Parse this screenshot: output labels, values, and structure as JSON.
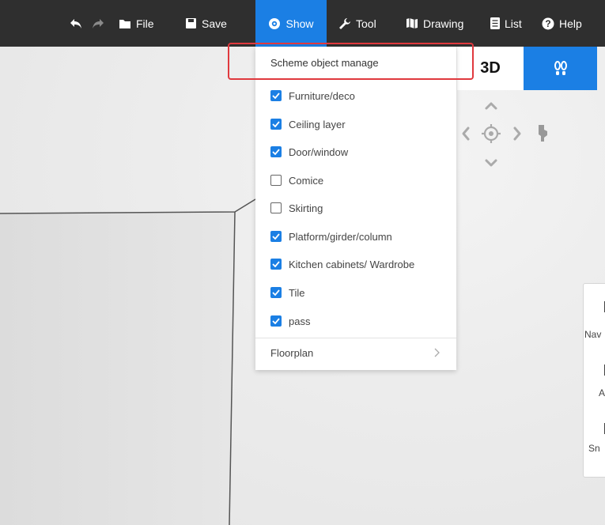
{
  "toolbar": {
    "items": [
      {
        "icon": "undo-icon",
        "label": ""
      },
      {
        "icon": "redo-icon",
        "label": ""
      },
      {
        "icon": "folder-icon",
        "label": "File"
      },
      {
        "icon": "save-icon",
        "label": "Save"
      },
      {
        "icon": "eye-icon",
        "label": "Show"
      },
      {
        "icon": "wrench-icon",
        "label": "Tool"
      },
      {
        "icon": "map-icon",
        "label": "Drawing"
      },
      {
        "icon": "list-icon",
        "label": "List"
      },
      {
        "icon": "help-icon",
        "label": "Help"
      }
    ],
    "active_label": "Show"
  },
  "view_toggle": {
    "three_d_label": "3D",
    "walk_icon": "footprints-icon"
  },
  "menu": {
    "header": "Scheme object manage",
    "items": [
      {
        "label": "Furniture/deco",
        "checked": true
      },
      {
        "label": "Ceiling layer",
        "checked": true
      },
      {
        "label": "Door/window",
        "checked": true
      },
      {
        "label": "Comice",
        "checked": false
      },
      {
        "label": "Skirting",
        "checked": false
      },
      {
        "label": "Platform/girder/column",
        "checked": true
      },
      {
        "label": "Kitchen cabinets/ Wardrobe",
        "checked": true
      },
      {
        "label": "Tile",
        "checked": true
      },
      {
        "label": "pass",
        "checked": true
      }
    ],
    "floorplan_label": "Floorplan"
  },
  "side_panel": {
    "labels": [
      "Nav",
      "A",
      "Sn"
    ]
  },
  "colors": {
    "toolbar_bg": "#2f2f2f",
    "accent": "#1b7fe4",
    "highlight": "#e0393e"
  }
}
